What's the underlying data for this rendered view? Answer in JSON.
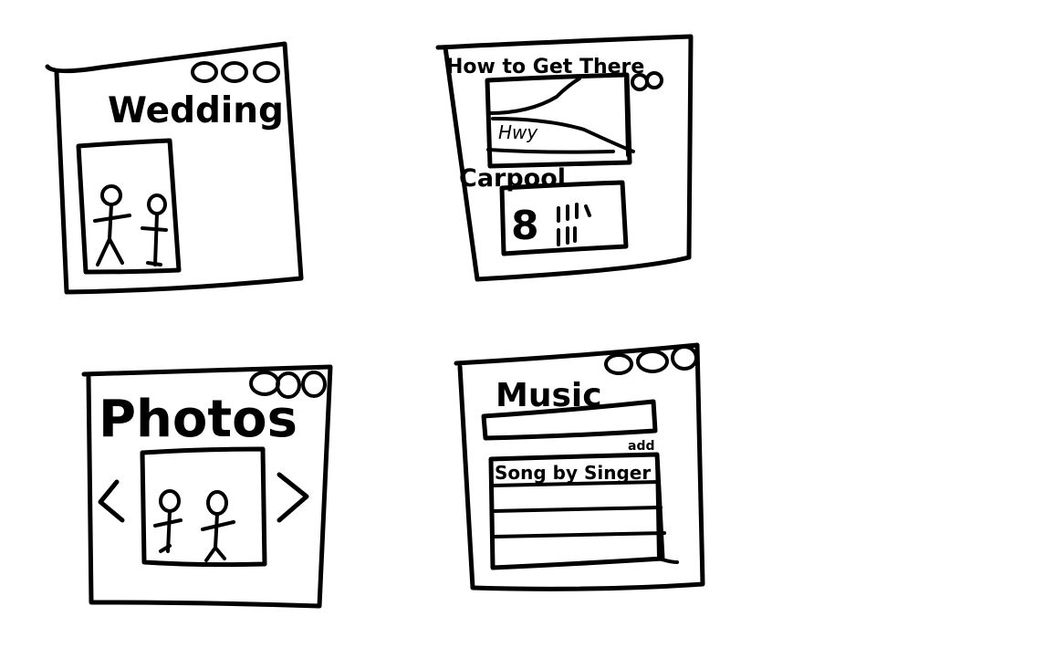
{
  "panels": {
    "wedding": {
      "title": "Wedding"
    },
    "directions": {
      "title": "How to Get There",
      "map_label": "Hwy",
      "carpool_title": "Carpool",
      "carpool_count": "8"
    },
    "photos": {
      "title": "Photos"
    },
    "music": {
      "title": "Music",
      "add_label": "add",
      "first_row": "Song by Singer"
    }
  },
  "icons": {
    "window_controls": "three-circles-icon",
    "couple": "stick-figures-icon",
    "prev": "chevron-left-icon",
    "next": "chevron-right-icon"
  }
}
